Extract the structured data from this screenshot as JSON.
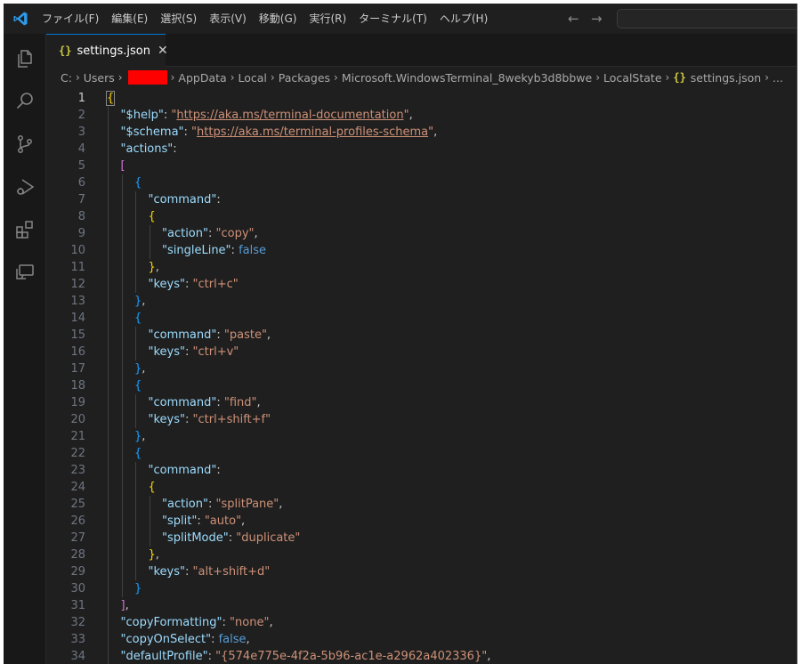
{
  "menu": [
    "ファイル(F)",
    "編集(E)",
    "選択(S)",
    "表示(V)",
    "移動(G)",
    "実行(R)",
    "ターミナル(T)",
    "ヘルプ(H)"
  ],
  "nav": {
    "back": "←",
    "forward": "→"
  },
  "tab": {
    "icon": "{}",
    "label": "settings.json",
    "close": "✕"
  },
  "breadcrumb": {
    "items": [
      "C:",
      "Users",
      "AppData",
      "Local",
      "Packages",
      "Microsoft.WindowsTerminal_8wekyb3d8bbwe",
      "LocalState"
    ],
    "file_icon": "{}",
    "file": "settings.json",
    "ellipsis": "..."
  },
  "colors": {
    "accent": "#0078d4",
    "redaction": "#ff0000",
    "json_icon": "#cbcb41"
  },
  "icons": [
    "explorer-icon",
    "search-icon",
    "source-control-icon",
    "run-debug-icon",
    "extensions-icon",
    "remote-explorer-icon"
  ],
  "lines": [
    {
      "n": "1",
      "indent": 0,
      "t": [
        [
          "{",
          "br1"
        ]
      ]
    },
    {
      "n": "2",
      "indent": 1,
      "t": [
        [
          "\"$help\"",
          "k"
        ],
        [
          ": ",
          "p"
        ],
        [
          "\"",
          "s"
        ],
        [
          "https://aka.ms/terminal-documentation",
          "u"
        ],
        [
          "\"",
          "s"
        ],
        [
          ",",
          "p"
        ]
      ]
    },
    {
      "n": "3",
      "indent": 1,
      "t": [
        [
          "\"$schema\"",
          "k"
        ],
        [
          ": ",
          "p"
        ],
        [
          "\"",
          "s"
        ],
        [
          "https://aka.ms/terminal-profiles-schema",
          "u"
        ],
        [
          "\"",
          "s"
        ],
        [
          ",",
          "p"
        ]
      ]
    },
    {
      "n": "4",
      "indent": 1,
      "t": [
        [
          "\"actions\"",
          "k"
        ],
        [
          ":",
          "p"
        ]
      ]
    },
    {
      "n": "5",
      "indent": 1,
      "t": [
        [
          "[",
          "br2"
        ]
      ]
    },
    {
      "n": "6",
      "indent": 2,
      "t": [
        [
          "{",
          "br3"
        ]
      ]
    },
    {
      "n": "7",
      "indent": 3,
      "t": [
        [
          "\"command\"",
          "k"
        ],
        [
          ":",
          "p"
        ]
      ]
    },
    {
      "n": "8",
      "indent": 3,
      "t": [
        [
          "{",
          "br1"
        ]
      ]
    },
    {
      "n": "9",
      "indent": 4,
      "t": [
        [
          "\"action\"",
          "k"
        ],
        [
          ": ",
          "p"
        ],
        [
          "\"copy\"",
          "s"
        ],
        [
          ",",
          "p"
        ]
      ]
    },
    {
      "n": "10",
      "indent": 4,
      "t": [
        [
          "\"singleLine\"",
          "k"
        ],
        [
          ": ",
          "p"
        ],
        [
          "false",
          "b"
        ]
      ]
    },
    {
      "n": "11",
      "indent": 3,
      "t": [
        [
          "}",
          "br1"
        ],
        [
          ",",
          "p"
        ]
      ]
    },
    {
      "n": "12",
      "indent": 3,
      "t": [
        [
          "\"keys\"",
          "k"
        ],
        [
          ": ",
          "p"
        ],
        [
          "\"ctrl+c\"",
          "s"
        ]
      ]
    },
    {
      "n": "13",
      "indent": 2,
      "t": [
        [
          "}",
          "br3"
        ],
        [
          ",",
          "p"
        ]
      ]
    },
    {
      "n": "14",
      "indent": 2,
      "t": [
        [
          "{",
          "br3"
        ]
      ]
    },
    {
      "n": "15",
      "indent": 3,
      "t": [
        [
          "\"command\"",
          "k"
        ],
        [
          ": ",
          "p"
        ],
        [
          "\"paste\"",
          "s"
        ],
        [
          ",",
          "p"
        ]
      ]
    },
    {
      "n": "16",
      "indent": 3,
      "t": [
        [
          "\"keys\"",
          "k"
        ],
        [
          ": ",
          "p"
        ],
        [
          "\"ctrl+v\"",
          "s"
        ]
      ]
    },
    {
      "n": "17",
      "indent": 2,
      "t": [
        [
          "}",
          "br3"
        ],
        [
          ",",
          "p"
        ]
      ]
    },
    {
      "n": "18",
      "indent": 2,
      "t": [
        [
          "{",
          "br3"
        ]
      ]
    },
    {
      "n": "19",
      "indent": 3,
      "t": [
        [
          "\"command\"",
          "k"
        ],
        [
          ": ",
          "p"
        ],
        [
          "\"find\"",
          "s"
        ],
        [
          ",",
          "p"
        ]
      ]
    },
    {
      "n": "20",
      "indent": 3,
      "t": [
        [
          "\"keys\"",
          "k"
        ],
        [
          ": ",
          "p"
        ],
        [
          "\"ctrl+shift+f\"",
          "s"
        ]
      ]
    },
    {
      "n": "21",
      "indent": 2,
      "t": [
        [
          "}",
          "br3"
        ],
        [
          ",",
          "p"
        ]
      ]
    },
    {
      "n": "22",
      "indent": 2,
      "t": [
        [
          "{",
          "br3"
        ]
      ]
    },
    {
      "n": "23",
      "indent": 3,
      "t": [
        [
          "\"command\"",
          "k"
        ],
        [
          ":",
          "p"
        ]
      ]
    },
    {
      "n": "24",
      "indent": 3,
      "t": [
        [
          "{",
          "br1"
        ]
      ]
    },
    {
      "n": "25",
      "indent": 4,
      "t": [
        [
          "\"action\"",
          "k"
        ],
        [
          ": ",
          "p"
        ],
        [
          "\"splitPane\"",
          "s"
        ],
        [
          ",",
          "p"
        ]
      ]
    },
    {
      "n": "26",
      "indent": 4,
      "t": [
        [
          "\"split\"",
          "k"
        ],
        [
          ": ",
          "p"
        ],
        [
          "\"auto\"",
          "s"
        ],
        [
          ",",
          "p"
        ]
      ]
    },
    {
      "n": "27",
      "indent": 4,
      "t": [
        [
          "\"splitMode\"",
          "k"
        ],
        [
          ": ",
          "p"
        ],
        [
          "\"duplicate\"",
          "s"
        ]
      ]
    },
    {
      "n": "28",
      "indent": 3,
      "t": [
        [
          "}",
          "br1"
        ],
        [
          ",",
          "p"
        ]
      ]
    },
    {
      "n": "29",
      "indent": 3,
      "t": [
        [
          "\"keys\"",
          "k"
        ],
        [
          ": ",
          "p"
        ],
        [
          "\"alt+shift+d\"",
          "s"
        ]
      ]
    },
    {
      "n": "30",
      "indent": 2,
      "t": [
        [
          "}",
          "br3"
        ]
      ]
    },
    {
      "n": "31",
      "indent": 1,
      "t": [
        [
          "]",
          "br2"
        ],
        [
          ",",
          "p"
        ]
      ]
    },
    {
      "n": "32",
      "indent": 1,
      "t": [
        [
          "\"copyFormatting\"",
          "k"
        ],
        [
          ": ",
          "p"
        ],
        [
          "\"none\"",
          "s"
        ],
        [
          ",",
          "p"
        ]
      ]
    },
    {
      "n": "33",
      "indent": 1,
      "t": [
        [
          "\"copyOnSelect\"",
          "k"
        ],
        [
          ": ",
          "p"
        ],
        [
          "false",
          "b"
        ],
        [
          ",",
          "p"
        ]
      ]
    },
    {
      "n": "34",
      "indent": 1,
      "t": [
        [
          "\"defaultProfile\"",
          "k"
        ],
        [
          ": ",
          "p"
        ],
        [
          "\"{574e775e-4f2a-5b96-ac1e-a2962a402336}\"",
          "s"
        ],
        [
          ",",
          "p"
        ]
      ]
    }
  ]
}
